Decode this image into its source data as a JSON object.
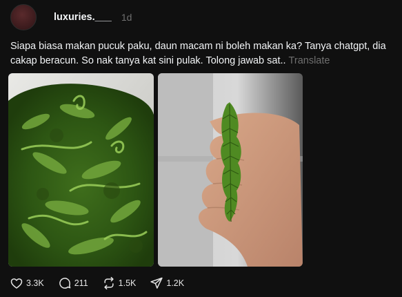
{
  "post": {
    "username": "luxuries.___",
    "time": "1d",
    "caption": "Siapa biasa makan pucuk paku, daun macam ni boleh makan ka? Tanya chatgpt, dia cakap beracun. So nak tanya kat sini pulak. Tolong jawab sat..",
    "translate_label": "Translate"
  },
  "actions": {
    "likes": "3.3K",
    "comments": "211",
    "reposts": "1.5K",
    "shares": "1.2K"
  },
  "icons": [
    "heart-icon",
    "comment-icon",
    "repost-icon",
    "share-icon"
  ],
  "colors": {
    "background": "#101010",
    "text": "#f3f5f7",
    "muted": "#6f6f6f"
  }
}
